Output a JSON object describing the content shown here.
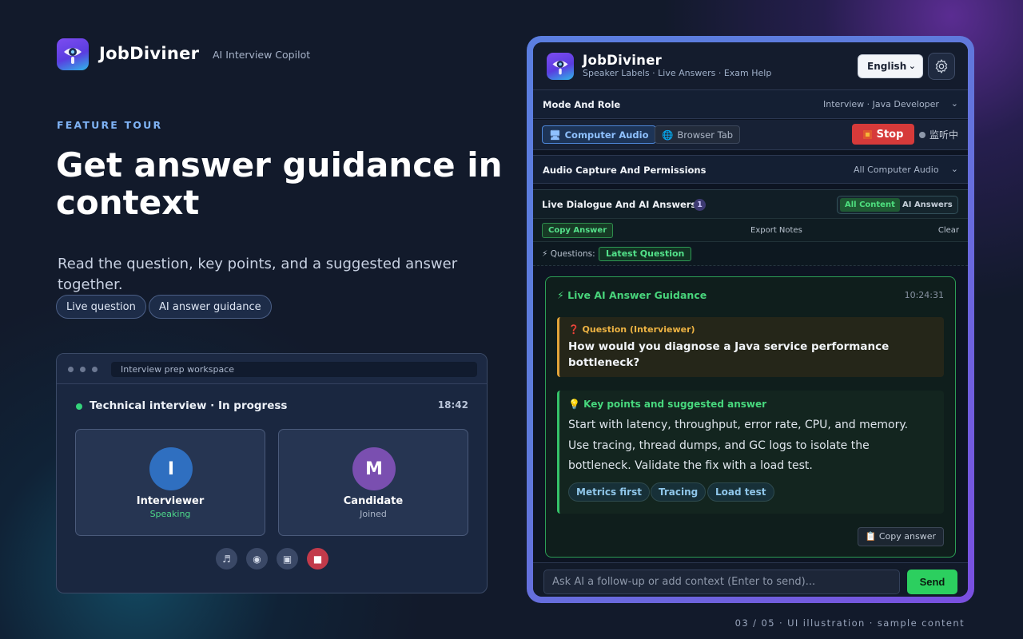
{
  "brand": {
    "name": "JobDiviner",
    "tagline": "AI Interview Copilot"
  },
  "hero": {
    "eyebrow": "FEATURE TOUR",
    "headline": "Get answer guidance in context",
    "lede": "Read the question, key points, and a suggested answer together.",
    "chips": [
      "Live question",
      "AI answer guidance"
    ]
  },
  "workspace": {
    "url": "Interview prep workspace",
    "status": "Technical interview · In progress",
    "timer": "18:42",
    "participants": [
      {
        "initial": "I",
        "name": "Interviewer",
        "state": "Speaking",
        "color": "#2f6fc0",
        "state_color": "#4ed88a"
      },
      {
        "initial": "M",
        "name": "Candidate",
        "state": "Joined",
        "color": "#7a4fb0",
        "state_color": "#a8b3c6"
      }
    ],
    "controls": [
      "music-icon",
      "record-icon",
      "screen-icon",
      "stop-icon"
    ]
  },
  "panel": {
    "title": "JobDiviner",
    "subtitle": "Speaker Labels · Live Answers · Exam Help",
    "language": "English",
    "mode": {
      "label": "Mode And Role",
      "value": "Interview · Java Developer"
    },
    "sources": {
      "computer_audio": "Computer Audio",
      "browser_tab": "Browser Tab",
      "stop": "Stop",
      "listening": "监听中"
    },
    "capture": {
      "label": "Audio Capture And Permissions",
      "value": "All Computer Audio"
    },
    "dialogue": {
      "label": "Live Dialogue And AI Answers",
      "count": "1",
      "filter_all": "All Content",
      "filter_ai": "AI Answers",
      "copy_answer": "Copy Answer",
      "export": "Export Notes",
      "clear": "Clear",
      "questions_label": "⚡ Questions:",
      "latest": "Latest Question"
    },
    "answer": {
      "title": "⚡ Live AI Answer Guidance",
      "time": "10:24:31",
      "question_label": "❓ Question (Interviewer)",
      "question": "How would you diagnose a Java service performance bottleneck?",
      "key_label": "💡 Key points and suggested answer",
      "key_text": "Start with latency, throughput, error rate, CPU, and memory. Use tracing, thread dumps, and GC logs to isolate the bottleneck. Validate the fix with a load test.",
      "tags": [
        "Metrics first",
        "Tracing",
        "Load test"
      ],
      "copy": "📋 Copy answer"
    },
    "input": {
      "placeholder": "Ask AI a follow-up or add context (Enter to send)...",
      "send": "Send"
    }
  },
  "footer": "03 / 05  ·  UI illustration · sample content",
  "colors": {
    "accent_green": "#2ccf5f",
    "stop_red": "#d63a3a",
    "brand_purple": "#7d4cf0"
  }
}
